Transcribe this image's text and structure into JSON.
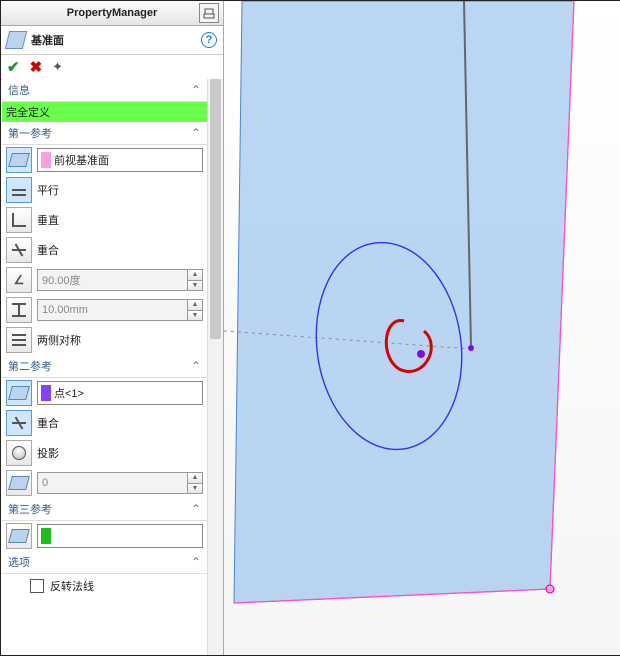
{
  "header": {
    "title": "PropertyManager"
  },
  "feature": {
    "title": "基准面"
  },
  "info": {
    "header": "信息",
    "status": "完全定义"
  },
  "ref1": {
    "header": "第一参考",
    "entity": "前视基准面",
    "parallel": "平行",
    "perpendicular": "垂直",
    "coincident": "重合",
    "angle": "90.00度",
    "distance": "10.00mm",
    "symmetric": "两侧对称"
  },
  "ref2": {
    "header": "第二参考",
    "entity": "点<1>",
    "coincident": "重合",
    "project": "投影",
    "offset": "0"
  },
  "ref3": {
    "header": "第三参考",
    "entity": ""
  },
  "options": {
    "header": "选项",
    "flip": "反转法线"
  }
}
